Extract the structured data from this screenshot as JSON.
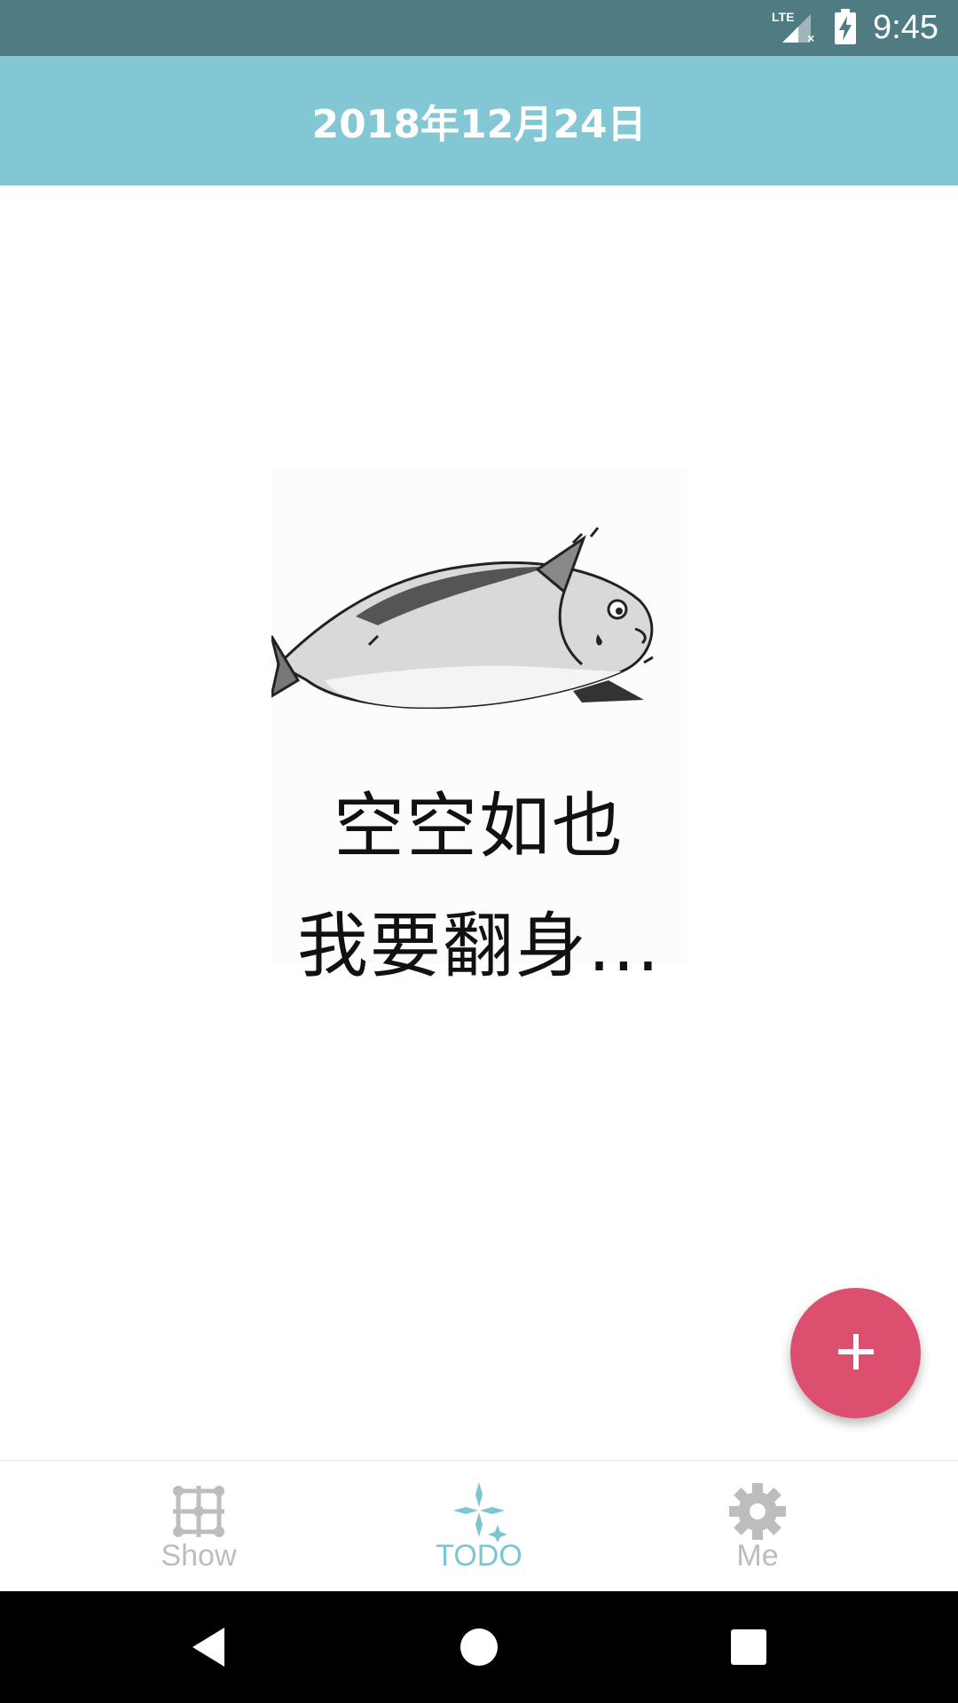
{
  "status_bar": {
    "time": "9:45",
    "network": "LTE",
    "icons": [
      "lte-signal-icon",
      "battery-charging-icon"
    ]
  },
  "app_bar": {
    "title": "2018年12月24日"
  },
  "empty_state": {
    "line1": "空空如也",
    "line2": "我要翻身...",
    "illustration": "fish-illustration"
  },
  "fab": {
    "icon": "plus-icon",
    "color": "#dc4f6e"
  },
  "bottom_nav": {
    "items": [
      {
        "label": "Show",
        "icon": "grid-nodes-icon",
        "active": false
      },
      {
        "label": "TODO",
        "icon": "sparkle-icon",
        "active": true
      },
      {
        "label": "Me",
        "icon": "gear-icon",
        "active": false
      }
    ],
    "active_color": "#7cc6d3",
    "inactive_color": "#bdbdbd"
  },
  "system_nav": {
    "buttons": [
      "back-icon",
      "home-icon",
      "recents-icon"
    ]
  },
  "colors": {
    "status_bar": "#4f7b82",
    "app_bar": "#82c7d3"
  }
}
